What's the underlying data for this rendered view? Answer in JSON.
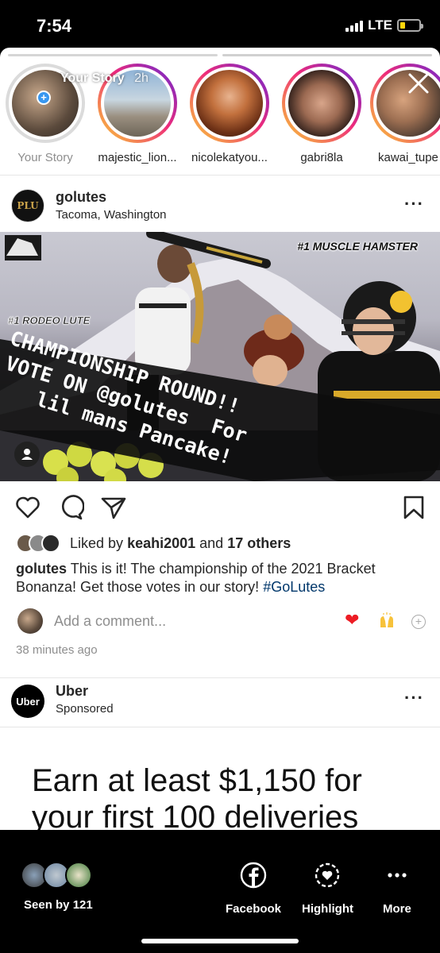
{
  "status_bar": {
    "time": "7:54",
    "network": "LTE",
    "battery_level": 0.25
  },
  "story_viewer": {
    "owner_label": "Your Story",
    "time_ago": "2h",
    "progress_segments": 2,
    "progress_completed": 1
  },
  "stories_tray": {
    "items": [
      {
        "name": "Your Story",
        "seen": true
      },
      {
        "name": "majestic_lion...",
        "seen": false
      },
      {
        "name": "nicolekatyou...",
        "seen": false
      },
      {
        "name": "gabri8la",
        "seen": false
      },
      {
        "name": "kawai_tupe",
        "seen": false
      }
    ]
  },
  "post": {
    "username": "golutes",
    "location": "Tacoma, Washington",
    "avatar_text": "PLU",
    "image": {
      "badge_left": "#1 RODEO LUTE",
      "badge_right": "#1 MUSCLE HAMSTER",
      "banner_line1": "CHAMPIONSHIP ROUND!!",
      "banner_line2": "VOTE ON @golutes  For",
      "banner_line3": "lil mans Pancake!"
    },
    "liked_by_user": "keahi2001",
    "liked_by_connector": "and",
    "liked_by_others": "17 others",
    "liked_by_prefix": "Liked by",
    "caption_user": "golutes",
    "caption_text": "This is it! The championship of the 2021 Bracket Bonanza! Get those votes in our  story!",
    "caption_hashtag": "#GoLutes",
    "comment_placeholder": "Add a comment...",
    "quick_emoji_heart": "❤",
    "timestamp": "38 minutes ago"
  },
  "ad": {
    "name": "Uber",
    "label": "Sponsored",
    "avatar_text": "Uber",
    "headline": "Earn at least $1,150 for your first 100 deliveries"
  },
  "bottom_bar": {
    "seen_by": "Seen by 121",
    "facebook": "Facebook",
    "highlight": "Highlight",
    "more": "More"
  },
  "colors": {
    "story_gradient_start": "#f9ce34",
    "story_gradient_mid": "#ee2a7b",
    "story_gradient_end": "#6228d7",
    "hashtag": "#00376b",
    "battery": "#ffd60a"
  }
}
